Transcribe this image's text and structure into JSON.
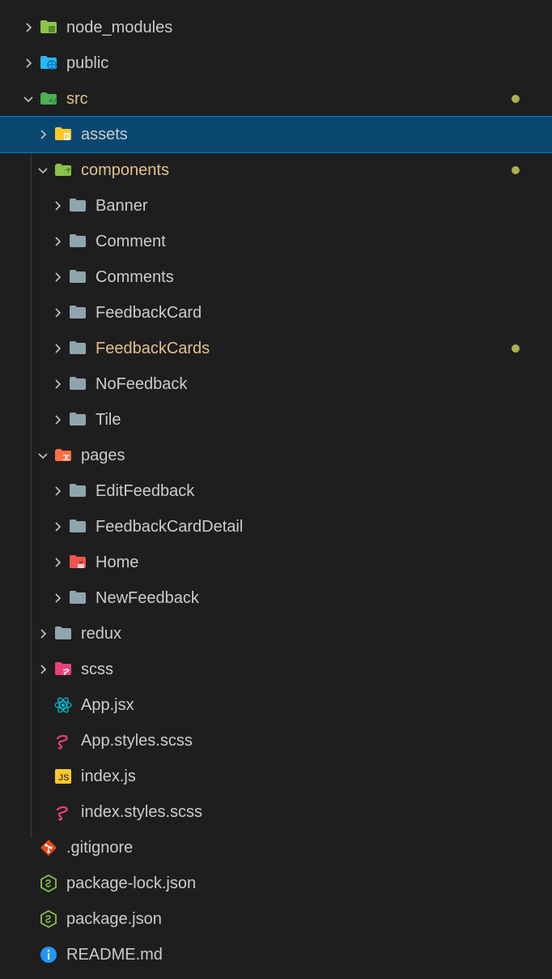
{
  "tree": [
    {
      "indent": 0,
      "chevron": "right",
      "icon": "folder-green-dim",
      "label": "node_modules",
      "modified": false,
      "dot": false,
      "selected": false
    },
    {
      "indent": 0,
      "chevron": "right",
      "icon": "folder-blue-globe",
      "label": "public",
      "modified": false,
      "dot": false,
      "selected": false
    },
    {
      "indent": 0,
      "chevron": "down",
      "icon": "folder-green-code",
      "label": "src",
      "modified": true,
      "dot": true,
      "selected": false
    },
    {
      "indent": 1,
      "chevron": "right",
      "icon": "folder-yellow-doc",
      "label": "assets",
      "modified": false,
      "dot": false,
      "selected": true
    },
    {
      "indent": 1,
      "chevron": "down",
      "icon": "folder-green-puzzle",
      "label": "components",
      "modified": true,
      "dot": true,
      "selected": false
    },
    {
      "indent": 2,
      "chevron": "right",
      "icon": "folder-gray",
      "label": "Banner",
      "modified": false,
      "dot": false,
      "selected": false
    },
    {
      "indent": 2,
      "chevron": "right",
      "icon": "folder-gray",
      "label": "Comment",
      "modified": false,
      "dot": false,
      "selected": false
    },
    {
      "indent": 2,
      "chevron": "right",
      "icon": "folder-gray",
      "label": "Comments",
      "modified": false,
      "dot": false,
      "selected": false
    },
    {
      "indent": 2,
      "chevron": "right",
      "icon": "folder-gray",
      "label": "FeedbackCard",
      "modified": false,
      "dot": false,
      "selected": false
    },
    {
      "indent": 2,
      "chevron": "right",
      "icon": "folder-gray",
      "label": "FeedbackCards",
      "modified": true,
      "dot": true,
      "selected": false
    },
    {
      "indent": 2,
      "chevron": "right",
      "icon": "folder-gray",
      "label": "NoFeedback",
      "modified": false,
      "dot": false,
      "selected": false
    },
    {
      "indent": 2,
      "chevron": "right",
      "icon": "folder-gray",
      "label": "Tile",
      "modified": false,
      "dot": false,
      "selected": false
    },
    {
      "indent": 1,
      "chevron": "down",
      "icon": "folder-orange-code",
      "label": "pages",
      "modified": false,
      "dot": false,
      "selected": false
    },
    {
      "indent": 2,
      "chevron": "right",
      "icon": "folder-gray",
      "label": "EditFeedback",
      "modified": false,
      "dot": false,
      "selected": false
    },
    {
      "indent": 2,
      "chevron": "right",
      "icon": "folder-gray",
      "label": "FeedbackCardDetail",
      "modified": false,
      "dot": false,
      "selected": false
    },
    {
      "indent": 2,
      "chevron": "right",
      "icon": "folder-pink-home",
      "label": "Home",
      "modified": false,
      "dot": false,
      "selected": false
    },
    {
      "indent": 2,
      "chevron": "right",
      "icon": "folder-gray",
      "label": "NewFeedback",
      "modified": false,
      "dot": false,
      "selected": false
    },
    {
      "indent": 1,
      "chevron": "right",
      "icon": "folder-gray",
      "label": "redux",
      "modified": false,
      "dot": false,
      "selected": false
    },
    {
      "indent": 1,
      "chevron": "right",
      "icon": "folder-pink-sass",
      "label": "scss",
      "modified": false,
      "dot": false,
      "selected": false
    },
    {
      "indent": 1,
      "chevron": "none",
      "icon": "react",
      "label": "App.jsx",
      "modified": false,
      "dot": false,
      "selected": false
    },
    {
      "indent": 1,
      "chevron": "none",
      "icon": "sass",
      "label": "App.styles.scss",
      "modified": false,
      "dot": false,
      "selected": false
    },
    {
      "indent": 1,
      "chevron": "none",
      "icon": "js",
      "label": "index.js",
      "modified": false,
      "dot": false,
      "selected": false
    },
    {
      "indent": 1,
      "chevron": "none",
      "icon": "sass",
      "label": "index.styles.scss",
      "modified": false,
      "dot": false,
      "selected": false
    },
    {
      "indent": 0,
      "chevron": "none",
      "icon": "git",
      "label": ".gitignore",
      "modified": false,
      "dot": false,
      "selected": false
    },
    {
      "indent": 0,
      "chevron": "none",
      "icon": "nodejs",
      "label": "package-lock.json",
      "modified": false,
      "dot": false,
      "selected": false
    },
    {
      "indent": 0,
      "chevron": "none",
      "icon": "nodejs",
      "label": "package.json",
      "modified": false,
      "dot": false,
      "selected": false
    },
    {
      "indent": 0,
      "chevron": "none",
      "icon": "info",
      "label": "README.md",
      "modified": false,
      "dot": false,
      "selected": false
    }
  ]
}
